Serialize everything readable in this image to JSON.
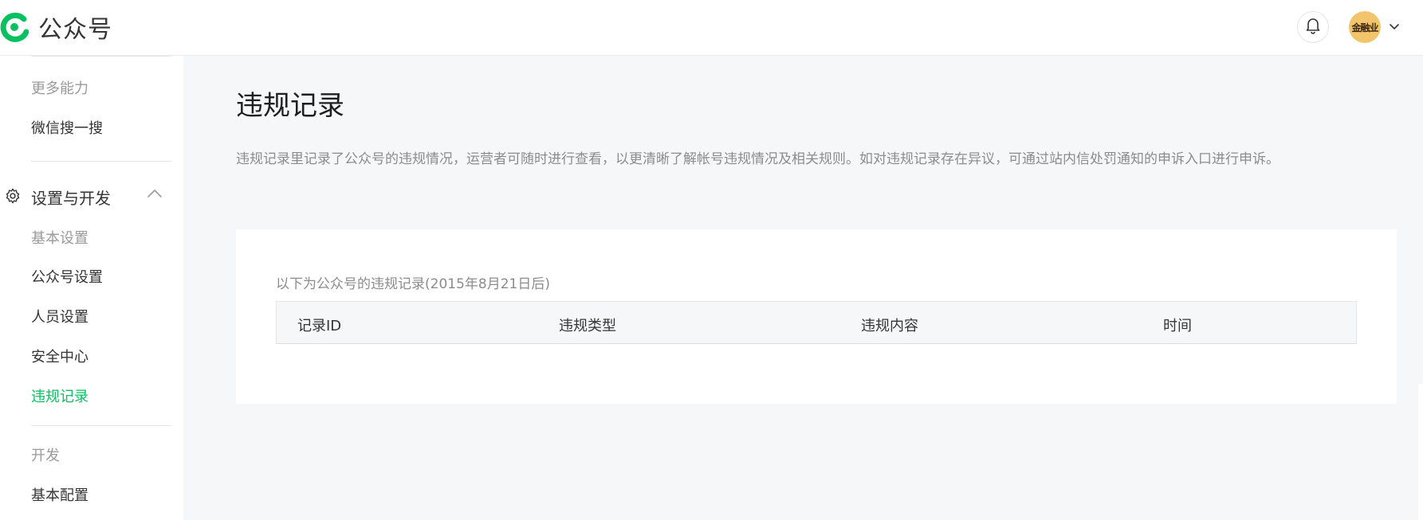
{
  "header": {
    "brand": "公众号",
    "logo_icon": "wechat-official-account-logo",
    "bell_icon": "bell-icon",
    "avatar_label": "金融业",
    "menu_icon": "chevron-down-icon"
  },
  "sidebar": {
    "more_group": {
      "title": "更多能力",
      "items": [
        "微信搜一搜"
      ]
    },
    "settings_section": {
      "label": "设置与开发",
      "icon": "gear-icon",
      "expanded": true
    },
    "basic_group": {
      "title": "基本设置",
      "items": [
        "公众号设置",
        "人员设置",
        "安全中心",
        "违规记录"
      ],
      "active": "违规记录"
    },
    "dev_group": {
      "title": "开发",
      "items": [
        "基本配置"
      ]
    }
  },
  "main": {
    "title": "违规记录",
    "description": "违规记录里记录了公众号的违规情况，运营者可随时进行查看，以更清晰了解帐号违规情况及相关规则。如对违规记录存在异议，可通过站内信处罚通知的申诉入口进行申诉。",
    "table_caption": "以下为公众号的违规记录(2015年8月21日后)",
    "columns": [
      "记录ID",
      "违规类型",
      "违规内容",
      "时间"
    ],
    "rows": []
  },
  "colors": {
    "accent": "#07c160",
    "background": "#f6f7f9",
    "text": "#353535",
    "muted": "#9a9a9a"
  }
}
